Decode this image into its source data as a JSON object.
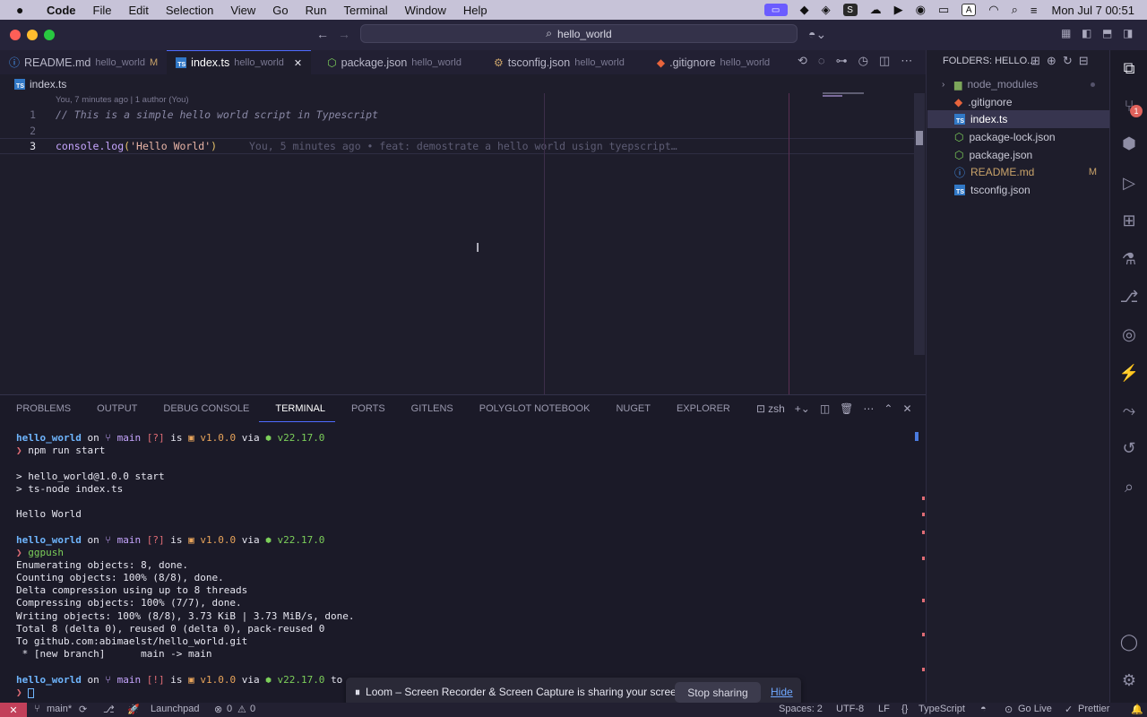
{
  "menubar": {
    "app": "Code",
    "items": [
      "File",
      "Edit",
      "Selection",
      "View",
      "Go",
      "Run",
      "Terminal",
      "Window",
      "Help"
    ],
    "clock": "Mon Jul 7  00:51",
    "input_source": "A"
  },
  "titlebar": {
    "search": "hello_world"
  },
  "tabs": [
    {
      "name": "README.md",
      "dir": "hello_world",
      "mod": "M"
    },
    {
      "name": "index.ts",
      "dir": "hello_world",
      "close": "✕"
    },
    {
      "name": "package.json",
      "dir": "hello_world"
    },
    {
      "name": "tsconfig.json",
      "dir": "hello_world"
    },
    {
      "name": ".gitignore",
      "dir": "hello_world"
    }
  ],
  "editor": {
    "breadcrumb": "index.ts",
    "blame_head": "You, 7 minutes ago | 1 author (You)",
    "lines": [
      "1",
      "2",
      "3"
    ],
    "line1": "// This is a simple hello world script in Typescript",
    "line3_fn": "console.log",
    "line3_open": "(",
    "line3_str": "'Hello World'",
    "line3_close": ")",
    "blame_inline": "You, 5 minutes ago • feat: demostrate a hello world usign tyepscript…"
  },
  "explorer": {
    "title": "FOLDERS: HELLO...",
    "files": [
      {
        "name": "node_modules"
      },
      {
        "name": ".gitignore"
      },
      {
        "name": "index.ts"
      },
      {
        "name": "package-lock.json"
      },
      {
        "name": "package.json"
      },
      {
        "name": "README.md",
        "badge": "M"
      },
      {
        "name": "tsconfig.json"
      }
    ]
  },
  "activity": {
    "badge": "1"
  },
  "panel": {
    "tabs": [
      "PROBLEMS",
      "OUTPUT",
      "DEBUG CONSOLE",
      "TERMINAL",
      "PORTS",
      "GITLENS",
      "POLYGLOT NOTEBOOK",
      "NUGET",
      "EXPLORER"
    ],
    "shell": "zsh"
  },
  "terminal": {
    "dir": "hello_world",
    "on": " on ",
    "branch": "main",
    "q1": "[?]",
    "q3": "[!]",
    "is": " is ",
    "ver": "v1.0.0",
    "via": " via ",
    "node": "v22.17.0",
    "cmd1": "npm run start",
    "out1": "> hello_world@1.0.0 start",
    "out2": "> ts-node index.ts",
    "out3": "Hello World",
    "cmd2": "ggpush",
    "git": [
      "Enumerating objects: 8, done.",
      "Counting objects: 100% (8/8), done.",
      "Delta compression using up to 8 threads",
      "Compressing objects: 100% (7/7), done.",
      "Writing objects: 100% (8/8), 3.73 KiB | 3.73 MiB/s, done.",
      "Total 8 (delta 0), reused 0 (delta 0), pack-reused 0",
      "To github.com:abimaelst/hello_world.git",
      " * [new branch]      main -> main"
    ],
    "to_fragment": "to"
  },
  "loom": {
    "message": "Loom – Screen Recorder & Screen Capture is sharing your screen.",
    "stop": "Stop sharing",
    "hide": "Hide"
  },
  "status": {
    "branch": "main*",
    "launchpad": "Launchpad",
    "problems": "0",
    "warnings": "0",
    "spaces": "Spaces: 2",
    "encoding": "UTF-8",
    "eol": "LF",
    "lang": "TypeScript",
    "golive": "Go Live",
    "prettier": "Prettier"
  }
}
